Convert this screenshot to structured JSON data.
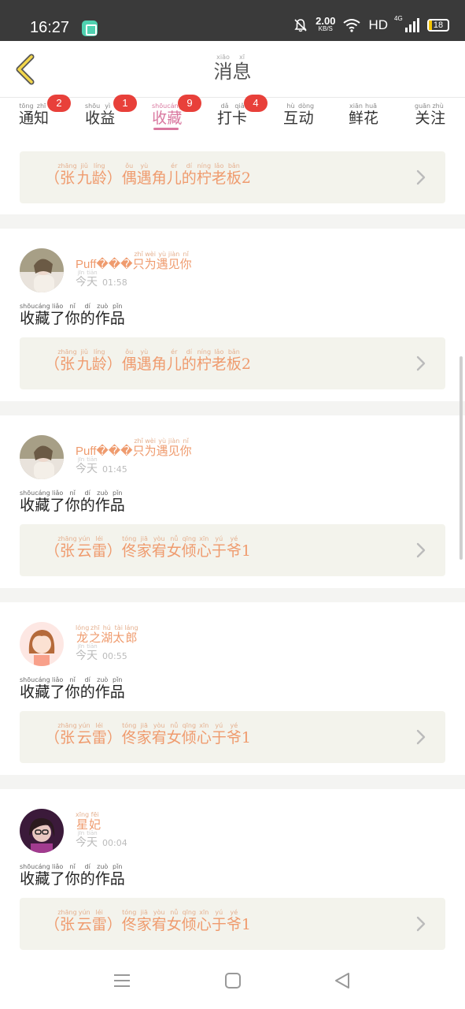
{
  "status_bar": {
    "time": "16:27",
    "speed_value": "2.00",
    "speed_unit": "KB/S",
    "hd": "HD",
    "network": "4G",
    "battery": "18"
  },
  "header": {
    "title": [
      {
        "ch": "消",
        "py": "xiāo"
      },
      {
        "ch": "息",
        "py": "xī"
      }
    ],
    "back_icon": "chevron-left-icon"
  },
  "tabs": [
    {
      "label": [
        {
          "ch": "通",
          "py": "tōng"
        },
        {
          "ch": "知",
          "py": "zhī"
        }
      ],
      "badge": "2",
      "active": false
    },
    {
      "label": [
        {
          "ch": "收",
          "py": "shōu"
        },
        {
          "ch": "益",
          "py": "yì"
        }
      ],
      "badge": "1",
      "active": false
    },
    {
      "label": [
        {
          "ch": "收",
          "py": "shōu"
        },
        {
          "ch": "藏",
          "py": "cáng"
        }
      ],
      "badge": "9",
      "active": true
    },
    {
      "label": [
        {
          "ch": "打",
          "py": "dǎ"
        },
        {
          "ch": "卡",
          "py": "qiǎ"
        }
      ],
      "badge": "4",
      "active": false
    },
    {
      "label": [
        {
          "ch": "互",
          "py": "hù"
        },
        {
          "ch": "动",
          "py": "dòng"
        }
      ],
      "badge": "",
      "active": false
    },
    {
      "label": [
        {
          "ch": "鲜",
          "py": "xiān"
        },
        {
          "ch": "花",
          "py": "huā"
        }
      ],
      "badge": "",
      "active": false
    },
    {
      "label": [
        {
          "ch": "关",
          "py": "guān"
        },
        {
          "ch": "注",
          "py": "zhù"
        }
      ],
      "badge": "",
      "active": false
    }
  ],
  "colors": {
    "accent": "#d9779f",
    "badge": "#e8403a",
    "work_text": "#ef9b6e",
    "work_bg": "#f3f3ec"
  },
  "first_work": {
    "segments": [
      {
        "t": "（"
      },
      {
        "ch": "张",
        "py": "zhāng"
      },
      {
        "ch": "九",
        "py": "jiǔ"
      },
      {
        "ch": "龄",
        "py": "líng"
      },
      {
        "t": "）"
      },
      {
        "ch": "偶",
        "py": "ǒu"
      },
      {
        "ch": "遇",
        "py": "yù"
      },
      {
        "ch": "角",
        "py": ""
      },
      {
        "ch": "儿",
        "py": "ér"
      },
      {
        "ch": "的",
        "py": "dí"
      },
      {
        "ch": "柠",
        "py": "níng"
      },
      {
        "ch": "老",
        "py": "lǎo"
      },
      {
        "ch": "板",
        "py": "bǎn"
      },
      {
        "t": "2"
      }
    ]
  },
  "items": [
    {
      "user": {
        "segments": [
          {
            "t": "Puff"
          },
          {
            "t": "���"
          },
          {
            "ch": "只",
            "py": "zhǐ"
          },
          {
            "ch": "为",
            "py": "wèi"
          },
          {
            "ch": "遇",
            "py": "yù"
          },
          {
            "ch": "见",
            "py": "jiàn"
          },
          {
            "ch": "你",
            "py": "nǐ"
          }
        ]
      },
      "day": [
        {
          "ch": "今",
          "py": "jīn"
        },
        {
          "ch": "天",
          "py": "tiān"
        }
      ],
      "time": "01:58",
      "avatar": "avatar-1",
      "action": [
        {
          "ch": "收",
          "py": "shōu"
        },
        {
          "ch": "藏",
          "py": "cáng"
        },
        {
          "ch": "了",
          "py": "liǎo"
        },
        {
          "ch": "你",
          "py": "nǐ"
        },
        {
          "ch": "的",
          "py": "dí"
        },
        {
          "ch": "作",
          "py": "zuò"
        },
        {
          "ch": "品",
          "py": "pǐn"
        }
      ],
      "work": {
        "segments": [
          {
            "t": "（"
          },
          {
            "ch": "张",
            "py": "zhāng"
          },
          {
            "ch": "九",
            "py": "jiǔ"
          },
          {
            "ch": "龄",
            "py": "líng"
          },
          {
            "t": "）"
          },
          {
            "ch": "偶",
            "py": "ǒu"
          },
          {
            "ch": "遇",
            "py": "yù"
          },
          {
            "ch": "角",
            "py": ""
          },
          {
            "ch": "儿",
            "py": "ér"
          },
          {
            "ch": "的",
            "py": "dí"
          },
          {
            "ch": "柠",
            "py": "níng"
          },
          {
            "ch": "老",
            "py": "lǎo"
          },
          {
            "ch": "板",
            "py": "bǎn"
          },
          {
            "t": "2"
          }
        ]
      }
    },
    {
      "user": {
        "segments": [
          {
            "t": "Puff"
          },
          {
            "t": "���"
          },
          {
            "ch": "只",
            "py": "zhǐ"
          },
          {
            "ch": "为",
            "py": "wèi"
          },
          {
            "ch": "遇",
            "py": "yù"
          },
          {
            "ch": "见",
            "py": "jiàn"
          },
          {
            "ch": "你",
            "py": "nǐ"
          }
        ]
      },
      "day": [
        {
          "ch": "今",
          "py": "jīn"
        },
        {
          "ch": "天",
          "py": "tiān"
        }
      ],
      "time": "01:45",
      "avatar": "avatar-1",
      "action": [
        {
          "ch": "收",
          "py": "shōu"
        },
        {
          "ch": "藏",
          "py": "cáng"
        },
        {
          "ch": "了",
          "py": "liǎo"
        },
        {
          "ch": "你",
          "py": "nǐ"
        },
        {
          "ch": "的",
          "py": "dí"
        },
        {
          "ch": "作",
          "py": "zuò"
        },
        {
          "ch": "品",
          "py": "pǐn"
        }
      ],
      "work": {
        "segments": [
          {
            "t": "（"
          },
          {
            "ch": "张",
            "py": "zhāng"
          },
          {
            "ch": "云",
            "py": "yún"
          },
          {
            "ch": "雷",
            "py": "léi"
          },
          {
            "t": "）"
          },
          {
            "ch": "佟",
            "py": "tóng"
          },
          {
            "ch": "家",
            "py": "jiā"
          },
          {
            "ch": "宥",
            "py": "yòu"
          },
          {
            "ch": "女",
            "py": "nǚ"
          },
          {
            "ch": "倾",
            "py": "qīng"
          },
          {
            "ch": "心",
            "py": "xīn"
          },
          {
            "ch": "于",
            "py": "yú"
          },
          {
            "ch": "爷",
            "py": "yé"
          },
          {
            "t": "1"
          }
        ]
      }
    },
    {
      "user": {
        "segments": [
          {
            "ch": "龙",
            "py": "lóng"
          },
          {
            "ch": "之",
            "py": "zhī"
          },
          {
            "ch": "湖",
            "py": "hú"
          },
          {
            "ch": "太",
            "py": "tài"
          },
          {
            "ch": "郎",
            "py": "láng"
          }
        ]
      },
      "day": [
        {
          "ch": "今",
          "py": "jīn"
        },
        {
          "ch": "天",
          "py": "tiān"
        }
      ],
      "time": "00:55",
      "avatar": "avatar-2",
      "action": [
        {
          "ch": "收",
          "py": "shōu"
        },
        {
          "ch": "藏",
          "py": "cáng"
        },
        {
          "ch": "了",
          "py": "liǎo"
        },
        {
          "ch": "你",
          "py": "nǐ"
        },
        {
          "ch": "的",
          "py": "dí"
        },
        {
          "ch": "作",
          "py": "zuò"
        },
        {
          "ch": "品",
          "py": "pǐn"
        }
      ],
      "work": {
        "segments": [
          {
            "t": "（"
          },
          {
            "ch": "张",
            "py": "zhāng"
          },
          {
            "ch": "云",
            "py": "yún"
          },
          {
            "ch": "雷",
            "py": "léi"
          },
          {
            "t": "）"
          },
          {
            "ch": "佟",
            "py": "tóng"
          },
          {
            "ch": "家",
            "py": "jiā"
          },
          {
            "ch": "宥",
            "py": "yòu"
          },
          {
            "ch": "女",
            "py": "nǚ"
          },
          {
            "ch": "倾",
            "py": "qīng"
          },
          {
            "ch": "心",
            "py": "xīn"
          },
          {
            "ch": "于",
            "py": "yú"
          },
          {
            "ch": "爷",
            "py": "yé"
          },
          {
            "t": "1"
          }
        ]
      }
    },
    {
      "user": {
        "segments": [
          {
            "ch": "星",
            "py": "xīng"
          },
          {
            "ch": "妃",
            "py": "fēi"
          }
        ]
      },
      "day": [
        {
          "ch": "今",
          "py": "jīn"
        },
        {
          "ch": "天",
          "py": "tiān"
        }
      ],
      "time": "00:04",
      "avatar": "avatar-3",
      "action": [
        {
          "ch": "收",
          "py": "shōu"
        },
        {
          "ch": "藏",
          "py": "cáng"
        },
        {
          "ch": "了",
          "py": "liǎo"
        },
        {
          "ch": "你",
          "py": "nǐ"
        },
        {
          "ch": "的",
          "py": "dí"
        },
        {
          "ch": "作",
          "py": "zuò"
        },
        {
          "ch": "品",
          "py": "pǐn"
        }
      ],
      "work": {
        "segments": [
          {
            "t": "（"
          },
          {
            "ch": "张",
            "py": "zhāng"
          },
          {
            "ch": "云",
            "py": "yún"
          },
          {
            "ch": "雷",
            "py": "léi"
          },
          {
            "t": "）"
          },
          {
            "ch": "佟",
            "py": "tóng"
          },
          {
            "ch": "家",
            "py": "jiā"
          },
          {
            "ch": "宥",
            "py": "yòu"
          },
          {
            "ch": "女",
            "py": "nǚ"
          },
          {
            "ch": "倾",
            "py": "qīng"
          },
          {
            "ch": "心",
            "py": "xīn"
          },
          {
            "ch": "于",
            "py": "yú"
          },
          {
            "ch": "爷",
            "py": "yé"
          },
          {
            "t": "1"
          }
        ]
      }
    }
  ],
  "nav": [
    "menu-icon",
    "home-square-icon",
    "back-triangle-icon"
  ]
}
